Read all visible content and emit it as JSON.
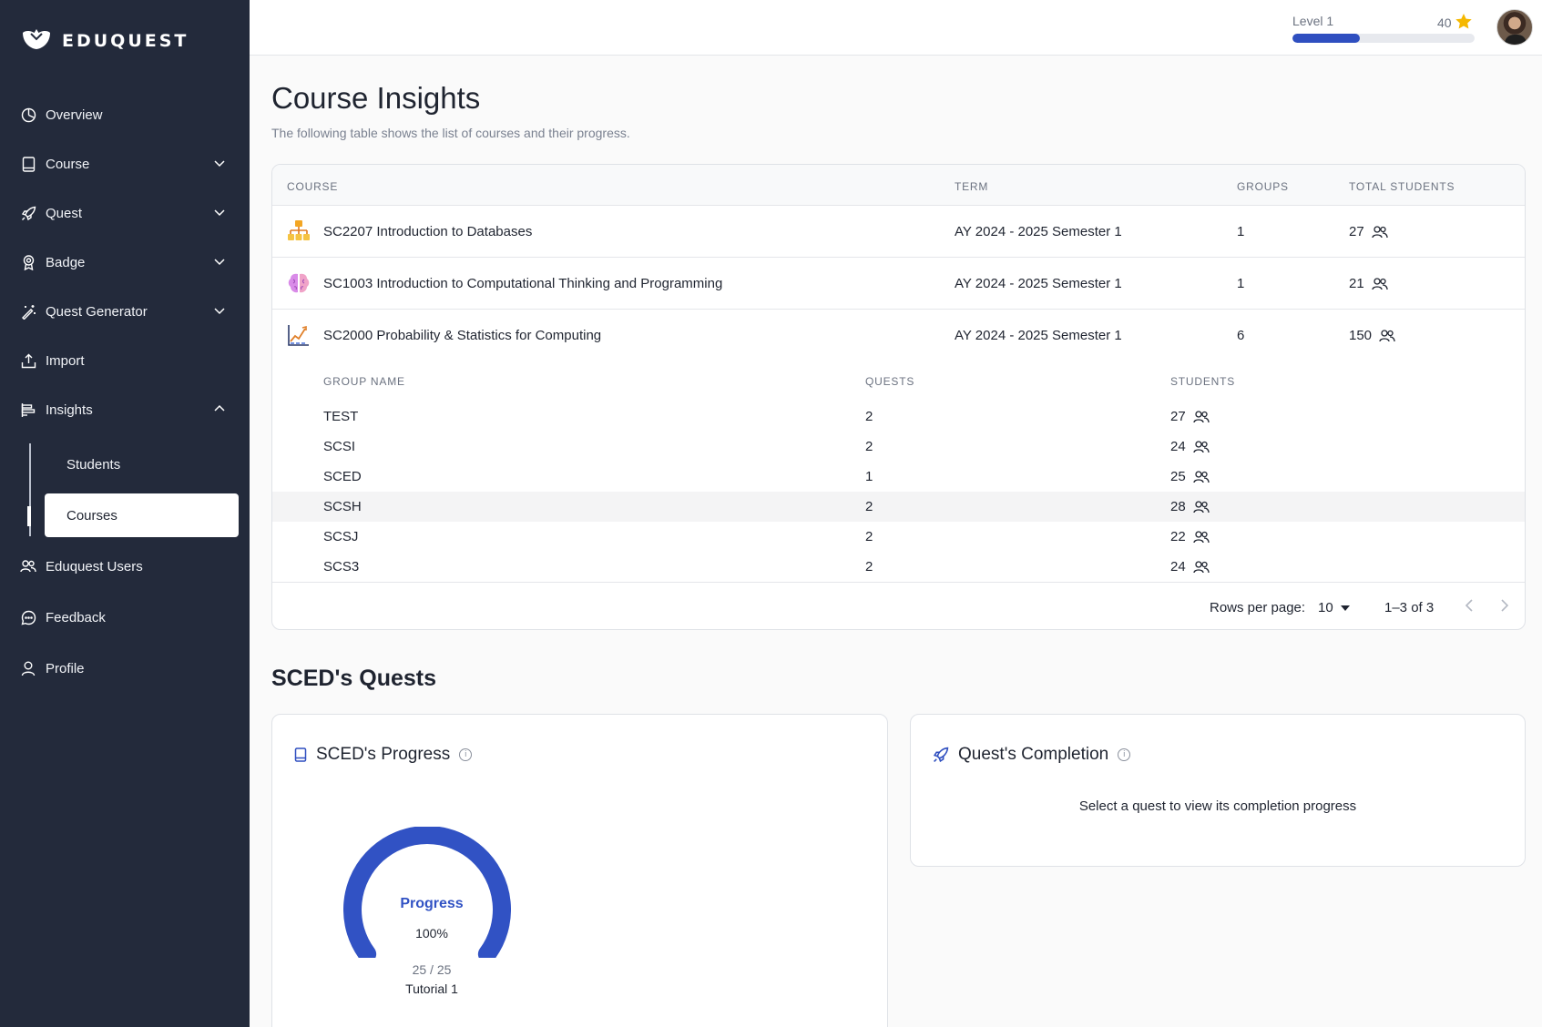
{
  "brand": {
    "name": "EDUQUEST"
  },
  "sidebar": {
    "items": [
      {
        "label": "Overview",
        "icon": "chart-pie-icon"
      },
      {
        "label": "Course",
        "icon": "book-icon"
      },
      {
        "label": "Quest",
        "icon": "rocket-icon"
      },
      {
        "label": "Badge",
        "icon": "badge-icon"
      },
      {
        "label": "Quest Generator",
        "icon": "magic-wand-icon"
      },
      {
        "label": "Import",
        "icon": "upload-icon"
      },
      {
        "label": "Insights",
        "icon": "insights-icon"
      },
      {
        "label": "Eduquest Users",
        "icon": "users-icon"
      },
      {
        "label": "Feedback",
        "icon": "chat-icon"
      },
      {
        "label": "Profile",
        "icon": "user-icon"
      }
    ],
    "insights_sub": [
      {
        "label": "Students"
      },
      {
        "label": "Courses",
        "active": true
      }
    ]
  },
  "topbar": {
    "level_label": "Level 1",
    "points": "40",
    "level_progress": 0.37,
    "colors": {
      "accent": "#2f4fc0",
      "star": "#f5b800"
    }
  },
  "page": {
    "title": "Course Insights",
    "subtitle": "The following table shows the list of courses and their progress."
  },
  "table": {
    "headers": {
      "course": "COURSE",
      "term": "TERM",
      "groups": "GROUPS",
      "total_students": "TOTAL STUDENTS"
    },
    "rows": [
      {
        "course": "SC2207 Introduction to Databases",
        "term": "AY 2024 - 2025 Semester 1",
        "groups": "1",
        "students": "27",
        "icon": "database-icon"
      },
      {
        "course": "SC1003 Introduction to Computational Thinking and Programming",
        "term": "AY 2024 - 2025 Semester 1",
        "groups": "1",
        "students": "21",
        "icon": "brain-icon"
      },
      {
        "course": "SC2000 Probability & Statistics for Computing",
        "term": "AY 2024 - 2025 Semester 1",
        "groups": "6",
        "students": "150",
        "icon": "statistics-icon"
      }
    ],
    "group_headers": {
      "name": "GROUP NAME",
      "quests": "QUESTS",
      "students": "STUDENTS"
    },
    "groups": [
      {
        "name": "TEST",
        "quests": "2",
        "students": "27"
      },
      {
        "name": "SCSI",
        "quests": "2",
        "students": "24"
      },
      {
        "name": "SCED",
        "quests": "1",
        "students": "25"
      },
      {
        "name": "SCSH",
        "quests": "2",
        "students": "28"
      },
      {
        "name": "SCSJ",
        "quests": "2",
        "students": "22"
      },
      {
        "name": "SCS3",
        "quests": "2",
        "students": "24"
      }
    ],
    "footer": {
      "rows_per_page_label": "Rows per page:",
      "rows_per_page": "10",
      "range": "1–3 of 3"
    }
  },
  "quests_section": {
    "title": "SCED's Quests",
    "progress_card": {
      "title": "SCED's Progress",
      "gauge_label": "Progress",
      "gauge_value": "100%",
      "gauge_fraction": 1.0,
      "count": "25 / 25",
      "tutorial": "Tutorial 1"
    },
    "completion_card": {
      "title": "Quest's Completion",
      "message": "Select a quest to view its completion progress"
    }
  }
}
